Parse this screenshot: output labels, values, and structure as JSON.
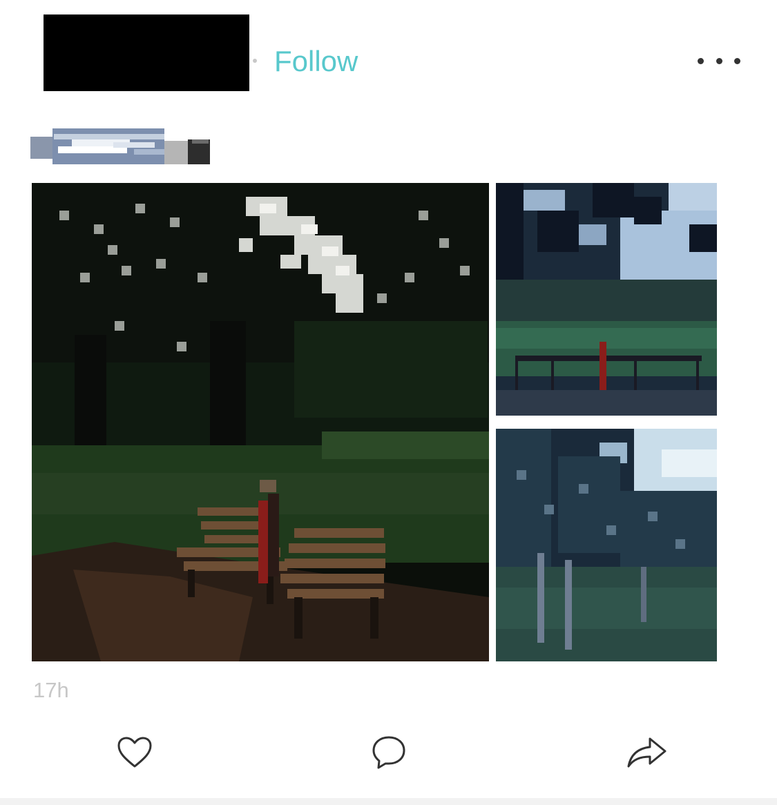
{
  "header": {
    "follow_label": "Follow"
  },
  "post": {
    "timestamp": "17h",
    "photos": [
      "photo-park-bench",
      "photo-park-fence",
      "photo-park-trees"
    ]
  },
  "actions": {
    "like_icon": "heart-icon",
    "comment_icon": "comment-bubble-icon",
    "share_icon": "share-arrow-icon",
    "more_icon": "more-dots-icon"
  },
  "colors": {
    "accent": "#58c8cc",
    "icon": "#333333",
    "muted_text": "#c7c7c7"
  }
}
